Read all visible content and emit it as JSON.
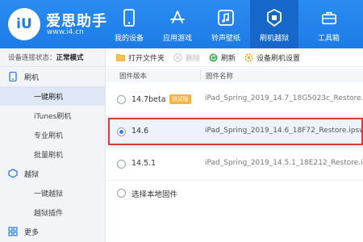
{
  "app": {
    "logo_text": "iU",
    "name": "爱思助手",
    "url": "www.i4.cn"
  },
  "nav": [
    {
      "label": "我的设备",
      "icon": "phone-icon"
    },
    {
      "label": "应用游戏",
      "icon": "app-store-icon"
    },
    {
      "label": "铃声壁纸",
      "icon": "music-icon"
    },
    {
      "label": "刷机越狱",
      "icon": "shield-box-icon",
      "active": true
    },
    {
      "label": "工具箱",
      "icon": "toolbox-icon"
    }
  ],
  "sidebar": {
    "status_label": "设备连接状态：",
    "status_value": "正常模式",
    "groups": [
      {
        "label": "刷机",
        "icon": "flash-device-icon",
        "items": [
          "一键刷机",
          "iTunes刷机",
          "专业刷机",
          "批量刷机"
        ]
      },
      {
        "label": "越狱",
        "icon": "jailbreak-icon",
        "items": [
          "一键越狱",
          "越狱插件"
        ]
      },
      {
        "label": "更多",
        "icon": "more-icon",
        "items": []
      }
    ],
    "active_item": "一键刷机"
  },
  "toolbar": {
    "open_folder": "打开文件夹",
    "delete": "删除",
    "refresh": "刷新",
    "settings": "设备刷机设置"
  },
  "table": {
    "col_version": "固件版本",
    "col_name": "固件名称",
    "rows": [
      {
        "version": "14.7beta",
        "badge": "测试版",
        "name": "iPad_Spring_2019_14.7_18G5023c_Restore.ip...",
        "selected": false
      },
      {
        "version": "14.6",
        "badge": "",
        "name": "iPad_Spring_2019_14.6_18F72_Restore.ipsw",
        "selected": true
      },
      {
        "version": "14.5.1",
        "badge": "",
        "name": "iPad_Spring_2019_14.5.1_18E212_Restore.ipsw",
        "selected": false
      }
    ],
    "local_option": "选择本地固件"
  },
  "colors": {
    "brand": "#1d7be6",
    "nav_active": "#1667c9",
    "highlight": "#d93a3a",
    "badge": "#f6b43c"
  }
}
